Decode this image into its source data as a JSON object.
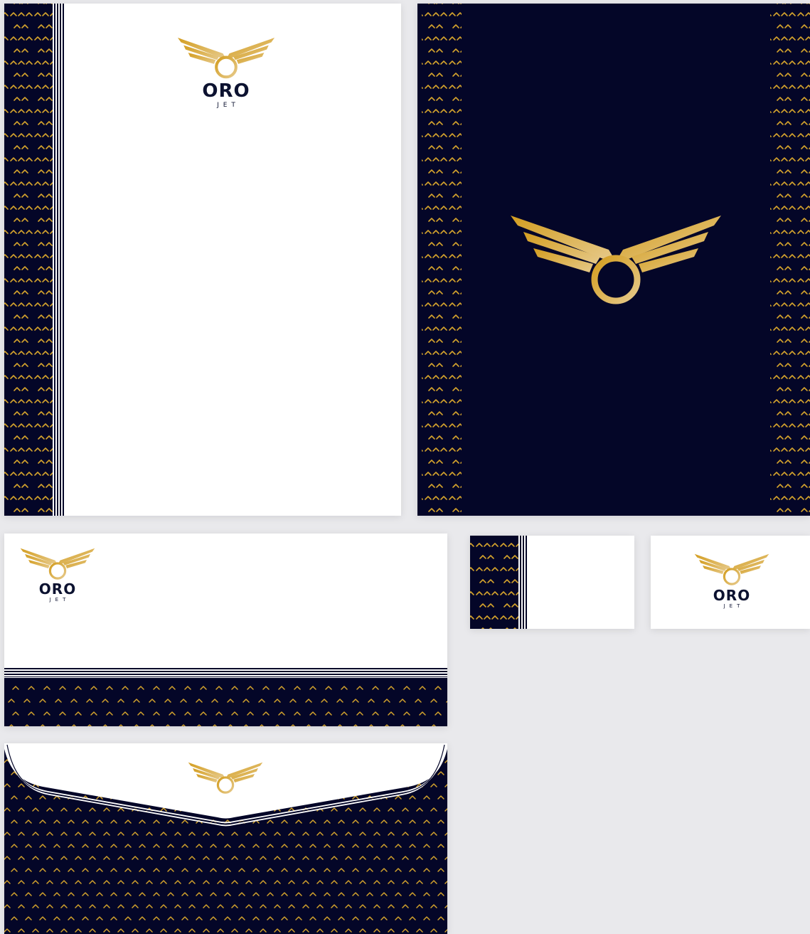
{
  "brand": {
    "name": "ORO",
    "tagline": "JET"
  },
  "colors": {
    "navy": "#040628",
    "gold": "#d4a32c",
    "gold_light": "#e3c27a",
    "white": "#ffffff",
    "background": "#e9e9ec"
  },
  "icons": {
    "logo": "winged-ring-logo-icon",
    "pattern": "chevron-pattern"
  }
}
